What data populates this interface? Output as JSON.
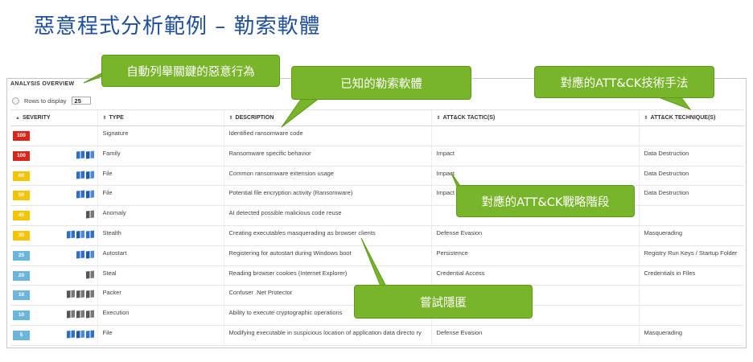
{
  "slide": {
    "title": "惡意程式分析範例 – 勒索軟體"
  },
  "panel": {
    "title": "ANALYSIS OVERVIEW",
    "rows_label": "Rows to display",
    "rows_value": "25"
  },
  "columns": [
    "SEVERITY",
    "TYPE",
    "DESCRIPTION",
    "ATT&CK TACTIC(S)",
    "ATT&CK TECHNIQUE(S)"
  ],
  "rows": [
    {
      "severity": "100",
      "color": "#d9261c",
      "icons": [],
      "type": "Signature",
      "description": "Identified ransomware code",
      "tactic": "",
      "technique": ""
    },
    {
      "severity": "100",
      "color": "#d9261c",
      "icons": [
        "windows-icon",
        "windows-icon"
      ],
      "type": "Family",
      "description": "Ransomware specific behavior",
      "tactic": "Impact",
      "technique": "Data Destruction"
    },
    {
      "severity": "60",
      "color": "#f5c400",
      "icons": [
        "windows-icon",
        "windows-icon"
      ],
      "type": "File",
      "description": "Common ransomware extension usage",
      "tactic": "Impact",
      "technique": "Data Destruction"
    },
    {
      "severity": "50",
      "color": "#f5c400",
      "icons": [
        "windows-icon",
        "windows-icon"
      ],
      "type": "File",
      "description": "Potential file encryption activity (Ransomware)",
      "tactic": "Impact",
      "technique": "Data Destruction"
    },
    {
      "severity": "45",
      "color": "#f5c400",
      "icons": [
        "windows-gray-icon"
      ],
      "type": "Anomaly",
      "description": "AI detected possible malicious code reuse",
      "tactic": "",
      "technique": ""
    },
    {
      "severity": "30",
      "color": "#f5c400",
      "icons": [
        "windows-icon",
        "windows-icon",
        "windows-icon"
      ],
      "type": "Stealth",
      "description": "Creating executables masquerading as browser clients",
      "tactic": "Defense Evasion",
      "technique": "Masquerading"
    },
    {
      "severity": "25",
      "color": "#6cb6dd",
      "icons": [
        "windows-icon",
        "windows-icon"
      ],
      "type": "Autostart",
      "description": "Registering for autostart during Windows boot",
      "tactic": "Persistence",
      "technique": "Registry Run Keys / Startup Folder"
    },
    {
      "severity": "20",
      "color": "#6cb6dd",
      "icons": [
        "windows-gray-icon"
      ],
      "type": "Steal",
      "description": "Reading browser cookies (Internet Explorer)",
      "tactic": "Credential Access",
      "technique": "Credentials in Files"
    },
    {
      "severity": "10",
      "color": "#6cb6dd",
      "icons": [
        "windows-gray-icon",
        "windows-gray-icon",
        "windows-gray-icon"
      ],
      "type": "Packer",
      "description": "Confuser .Net Protector",
      "tactic": "",
      "technique": ""
    },
    {
      "severity": "10",
      "color": "#6cb6dd",
      "icons": [
        "windows-gray-icon",
        "windows-gray-icon",
        "windows-gray-icon"
      ],
      "type": "Execution",
      "description": "Ability to execute cryptographic operations",
      "tactic": "",
      "technique": ""
    },
    {
      "severity": "5",
      "color": "#6cb6dd",
      "icons": [
        "windows-icon",
        "windows-icon",
        "windows-icon"
      ],
      "type": "File",
      "description": "Modifying executable in suspicious location of application data directo ry",
      "tactic": "Defense Evasion",
      "technique": "Masquerading"
    }
  ],
  "callouts": {
    "auto_list": "自動列舉關鍵的惡意行為",
    "known_ransomware": "已知的勒索軟體",
    "technique_map": "對應的ATT&CK技術手法",
    "tactic_map": "對應的ATT&CK戰略階段",
    "evasion": "嘗試隱匿"
  },
  "colors": {
    "callout_green": "#78b52a",
    "title_blue": "#1f4e9a"
  }
}
